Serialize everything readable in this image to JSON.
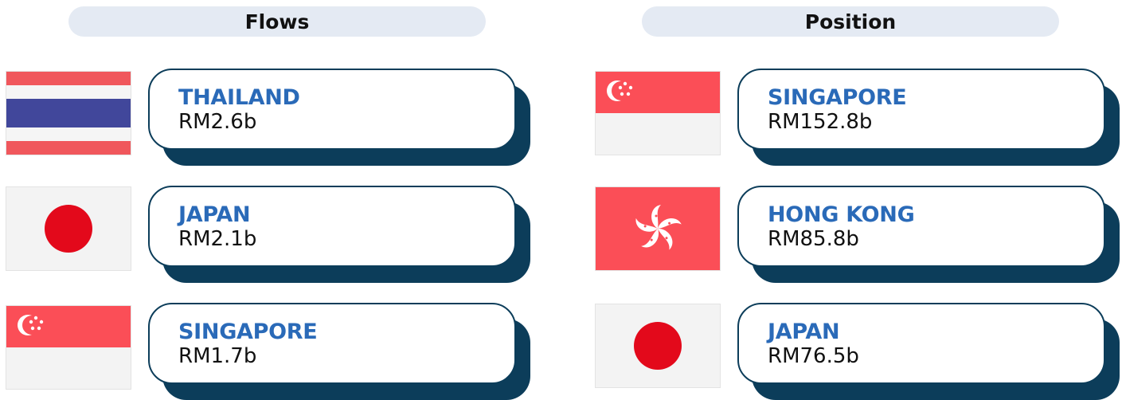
{
  "flows": {
    "header": "Flows",
    "items": [
      {
        "country": "THAILAND",
        "amount": "RM2.6b",
        "flag": "thailand-flag"
      },
      {
        "country": "JAPAN",
        "amount": "RM2.1b",
        "flag": "japan-flag"
      },
      {
        "country": "SINGAPORE",
        "amount": "RM1.7b",
        "flag": "singapore-flag"
      }
    ]
  },
  "position": {
    "header": "Position",
    "items": [
      {
        "country": "SINGAPORE",
        "amount": "RM152.8b",
        "flag": "singapore-flag"
      },
      {
        "country": "HONG KONG",
        "amount": "RM85.8b",
        "flag": "hong-kong-flag"
      },
      {
        "country": "JAPAN",
        "amount": "RM76.5b",
        "flag": "japan-flag"
      }
    ]
  },
  "colors": {
    "card_border": "#0c3d5a",
    "country_text": "#2a6ab8",
    "header_pill": "#e4eaf3"
  }
}
